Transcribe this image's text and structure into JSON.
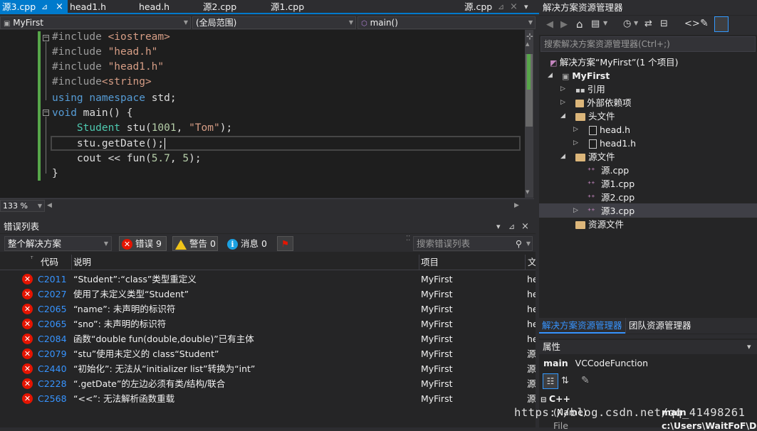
{
  "tabs": [
    {
      "label": "源3.cpp",
      "pin": "⊿",
      "close": "×",
      "active": true
    },
    {
      "label": "head1.h"
    },
    {
      "label": "head.h"
    },
    {
      "label": "源2.cpp"
    },
    {
      "label": "源1.cpp"
    },
    {
      "label": "源.cpp",
      "pin": "⊿",
      "close": "×"
    }
  ],
  "navbar": {
    "project": "MyFirst",
    "scope": "(全局范围)",
    "member": "main()"
  },
  "code": {
    "l1a": "#include ",
    "l1b": "<iostream>",
    "l2a": "#include ",
    "l2b": "\"head.h\"",
    "l3a": "#include ",
    "l3b": "\"head1.h\"",
    "l4a": "#include",
    "l4b": "<string>",
    "l5a": "using",
    "l5b": " namespace",
    "l5c": " std;",
    "l6a": "void",
    "l6b": " main() {",
    "l7a": "    Student",
    "l7b": " stu(",
    "l7c": "1001",
    "l7d": ", ",
    "l7e": "\"Tom\"",
    "l7f": ");",
    "l8": "    stu.getDate();",
    "l9a": "    cout << fun(",
    "l9b": "5.7",
    "l9c": ", ",
    "l9d": "5",
    "l9e": ");",
    "l10": "}"
  },
  "zoom": "133 %",
  "errorlist": {
    "title": "错误列表",
    "scope": "整个解决方案",
    "errors_label": "错误 9",
    "warnings_label": "警告 0",
    "messages_label": "消息 0",
    "search_placeholder": "搜索错误列表",
    "col_code": "代码",
    "col_desc": "说明",
    "col_project": "项目",
    "col_file": "文",
    "rows": [
      {
        "code": "C2011",
        "desc": "“Student”:“class”类型重定义",
        "project": "MyFirst",
        "file": "he"
      },
      {
        "code": "C2027",
        "desc": "使用了未定义类型“Student”",
        "project": "MyFirst",
        "file": "he"
      },
      {
        "code": "C2065",
        "desc": "“name”: 未声明的标识符",
        "project": "MyFirst",
        "file": "he"
      },
      {
        "code": "C2065",
        "desc": "“sno”: 未声明的标识符",
        "project": "MyFirst",
        "file": "he"
      },
      {
        "code": "C2084",
        "desc": "函数“double fun(double,double)”已有主体",
        "project": "MyFirst",
        "file": "he"
      },
      {
        "code": "C2079",
        "desc": "“stu”使用未定义的 class“Student”",
        "project": "MyFirst",
        "file": "源"
      },
      {
        "code": "C2440",
        "desc": "“初始化”: 无法从“initializer list”转换为“int”",
        "project": "MyFirst",
        "file": "源"
      },
      {
        "code": "C2228",
        "desc": "“.getDate”的左边必须有类/结构/联合",
        "project": "MyFirst",
        "file": "源"
      },
      {
        "code": "C2568",
        "desc": "“<<”: 无法解析函数重载",
        "project": "MyFirst",
        "file": "源"
      }
    ]
  },
  "solution": {
    "title": "解决方案资源管理器",
    "search_placeholder": "搜索解决方案资源管理器(Ctrl+;)",
    "items": [
      {
        "label": "解决方案“MyFirst”(1 个项目)"
      },
      {
        "label": "MyFirst"
      },
      {
        "label": "引用"
      },
      {
        "label": "外部依赖项"
      },
      {
        "label": "头文件"
      },
      {
        "label": "head.h"
      },
      {
        "label": "head1.h"
      },
      {
        "label": "源文件"
      },
      {
        "label": "源.cpp"
      },
      {
        "label": "源1.cpp"
      },
      {
        "label": "源2.cpp"
      },
      {
        "label": "源3.cpp"
      },
      {
        "label": "资源文件"
      }
    ],
    "tab_solution": "解决方案资源管理器",
    "tab_team": "团队资源管理器"
  },
  "properties": {
    "title": "属性",
    "object": "main",
    "object_type": "VCCodeFunction",
    "category": "C++",
    "name_label": "(Name)",
    "name_value": "main",
    "file_label": "File",
    "file_value": "c:\\Users\\WaitFoF\\Doc"
  },
  "watermark": "https://blog.csdn.net/qq_41498261",
  "colors": {
    "accent": "#007acc",
    "error": "#e51400",
    "link": "#3794ff",
    "changed": "#57a64a"
  }
}
